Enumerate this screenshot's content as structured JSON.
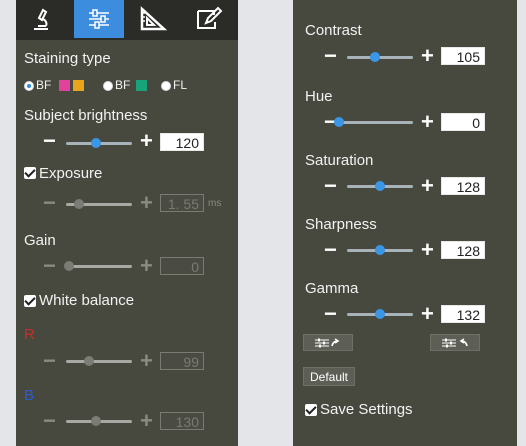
{
  "left": {
    "staining_label": "Staining type",
    "staining_options": [
      {
        "label": "BF",
        "selected": true,
        "swatches": [
          "#e0439b",
          "#e8a51c"
        ]
      },
      {
        "label": "BF",
        "selected": false,
        "swatches": [
          "#18a37a"
        ]
      },
      {
        "label": "FL",
        "selected": false,
        "swatches": []
      }
    ],
    "brightness": {
      "label": "Subject brightness",
      "value": "120",
      "fraction": 0.45
    },
    "exposure": {
      "label": "Exposure",
      "checked": true,
      "value": "1. 55",
      "unit": "ms",
      "fraction": 0.2
    },
    "gain": {
      "label": "Gain",
      "value": "0",
      "fraction": 0.0
    },
    "white_balance": {
      "label": "White balance",
      "checked": true
    },
    "red": {
      "label": "R",
      "value": "99",
      "fraction": 0.35,
      "color": "#c0302c"
    },
    "blue": {
      "label": "B",
      "value": "130",
      "fraction": 0.45,
      "color": "#2f5bd0"
    }
  },
  "right": {
    "contrast": {
      "label": "Contrast",
      "value": "105",
      "fraction": 0.42
    },
    "hue": {
      "label": "Hue",
      "value": "0",
      "fraction": 0.0
    },
    "saturation": {
      "label": "Saturation",
      "value": "128",
      "fraction": 0.5
    },
    "sharpness": {
      "label": "Sharpness",
      "value": "128",
      "fraction": 0.5
    },
    "gamma": {
      "label": "Gamma",
      "value": "132",
      "fraction": 0.5
    },
    "default_label": "Default",
    "save_label": "Save Settings",
    "save_checked": true
  },
  "icons": {
    "tool_microscope": "microscope-icon",
    "tool_adjust": "sliders-icon",
    "tool_measure": "ruler-triangle-icon",
    "tool_annotate": "edit-icon",
    "export": "sliders-export-icon",
    "import": "sliders-import-icon"
  },
  "colors": {
    "accent": "#3c8ddd",
    "panel": "#47483e",
    "toolbar": "#2b2c27"
  }
}
